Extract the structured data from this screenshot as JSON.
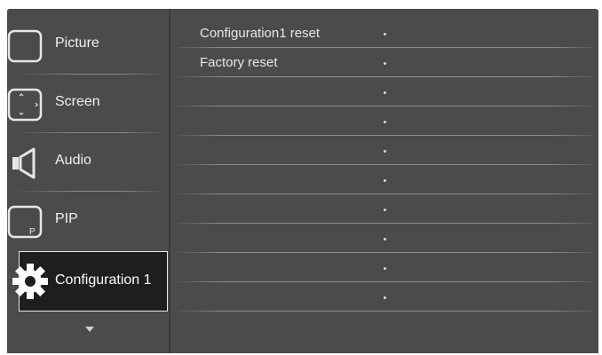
{
  "sidebar": {
    "items": [
      {
        "label": "Picture",
        "icon": "picture-icon"
      },
      {
        "label": "Screen",
        "icon": "screen-icon"
      },
      {
        "label": "Audio",
        "icon": "speaker-icon"
      },
      {
        "label": "PIP",
        "icon": "pip-icon",
        "icon_letter": "P"
      },
      {
        "label": "Configuration 1",
        "icon": "gear-icon",
        "selected": true
      }
    ],
    "scroll_indicator": "chevron-down-icon"
  },
  "content": {
    "rows": [
      {
        "label": "Configuration1 reset"
      },
      {
        "label": "Factory reset"
      },
      {
        "label": ""
      },
      {
        "label": ""
      },
      {
        "label": ""
      },
      {
        "label": ""
      },
      {
        "label": ""
      },
      {
        "label": ""
      },
      {
        "label": ""
      },
      {
        "label": ""
      }
    ]
  },
  "colors": {
    "background": "#4b4b4b",
    "selected_background": "#1e1e1e",
    "text": "#f0f0f0"
  }
}
